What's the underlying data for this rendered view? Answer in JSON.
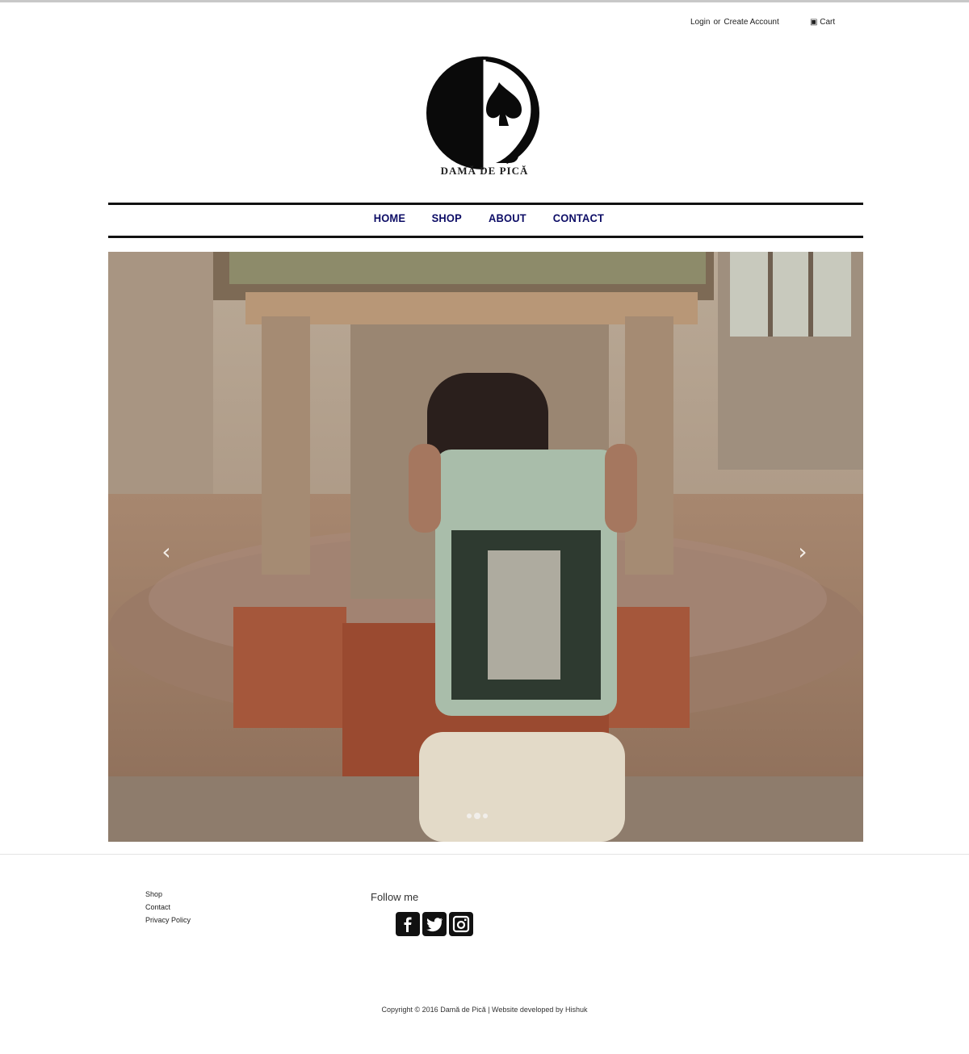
{
  "header": {
    "login_label": "Login",
    "or_label": "or",
    "create_account_label": "Create Account",
    "cart_label": "Cart",
    "brand_name": "DAMĂ DE PICĂ"
  },
  "nav": {
    "items": [
      "HOME",
      "SHOP",
      "ABOUT",
      "CONTACT"
    ]
  },
  "slider": {
    "prev_icon": "chevron-left-icon",
    "next_icon": "chevron-right-icon",
    "slide_count": 3,
    "active_slide": 2
  },
  "footer": {
    "links": [
      "Shop",
      "Contact",
      "Privacy Policy"
    ],
    "follow_label": "Follow me",
    "social_icons": [
      "facebook-icon",
      "twitter-icon",
      "instagram-icon"
    ],
    "copyright": "Copyright © 2016 Damă de Pică | Website developed by Hishuk"
  },
  "colors": {
    "nav_text": "#0d0d66",
    "rules": "#111111"
  }
}
